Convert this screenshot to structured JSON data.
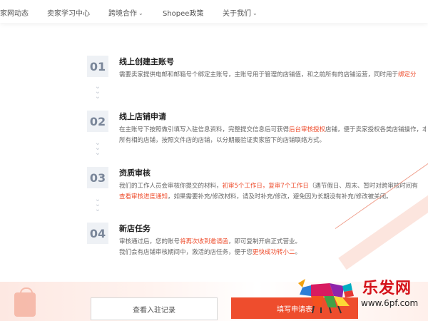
{
  "nav": {
    "items": [
      {
        "label": "家网动态",
        "has_dropdown": false
      },
      {
        "label": "卖家学习中心",
        "has_dropdown": false
      },
      {
        "label": "跨境合作",
        "has_dropdown": true
      },
      {
        "label": "Shopee政策",
        "has_dropdown": false
      },
      {
        "label": "关于我们",
        "has_dropdown": true
      }
    ]
  },
  "steps": [
    {
      "num": "01",
      "title": "线上创建主账号",
      "desc_before": "需要卖家提供电邮和邮箱号个绑定主账号，主账号用于管理的店铺值，和之前所有的店铺运营，同时用于",
      "desc_highlight": "绑定分",
      "desc_after": ""
    },
    {
      "num": "02",
      "title": "线上店铺申请",
      "line1_before": "在主账号下按照做引填写入驻信息资料，完整提交信息后可获得",
      "line1_highlight": "后台审核授权",
      "line1_after": "店铺，便于卖家授权各类店铺操作，本卖家",
      "line2": "所有相的店铺，按照文件店的店铺，以分期最验证卖家留下的店铺联络方式。"
    },
    {
      "num": "03",
      "title": "资质审核",
      "line1_before": "我们的工作人员会审核你提交的材料，",
      "line1_hl1": "初审5个工作日，复审7个工作日",
      "line1_after": "（遇节假日、周末、暂时对跨审核时间有",
      "line2_hl": "查看审核进度通知",
      "line2_after": "，如果需要补充/修改材料，请及时补充/修改，避免因为长期没有补充/修改被关闭。"
    },
    {
      "num": "04",
      "title": "新店任务",
      "line1_before": "审核通过后，您的账号",
      "line1_highlight": "将再次收到邀请函",
      "line1_after": "，即可复制开启正式营业。",
      "line2_before": "我们会有店铺审核期间中，激活的店任务，便于您",
      "line2_highlight": "更快成功转小二",
      "line2_after": "。"
    }
  ],
  "buttons": {
    "view_records": "查看入驻记录",
    "fill_application": "填写申请表"
  },
  "watermark": {
    "brand": "乐发网",
    "url": "www.6pf.com"
  },
  "colors": {
    "accent": "#ee4d2d",
    "step_bg": "#eef1f5",
    "step_num": "#7a8699"
  }
}
